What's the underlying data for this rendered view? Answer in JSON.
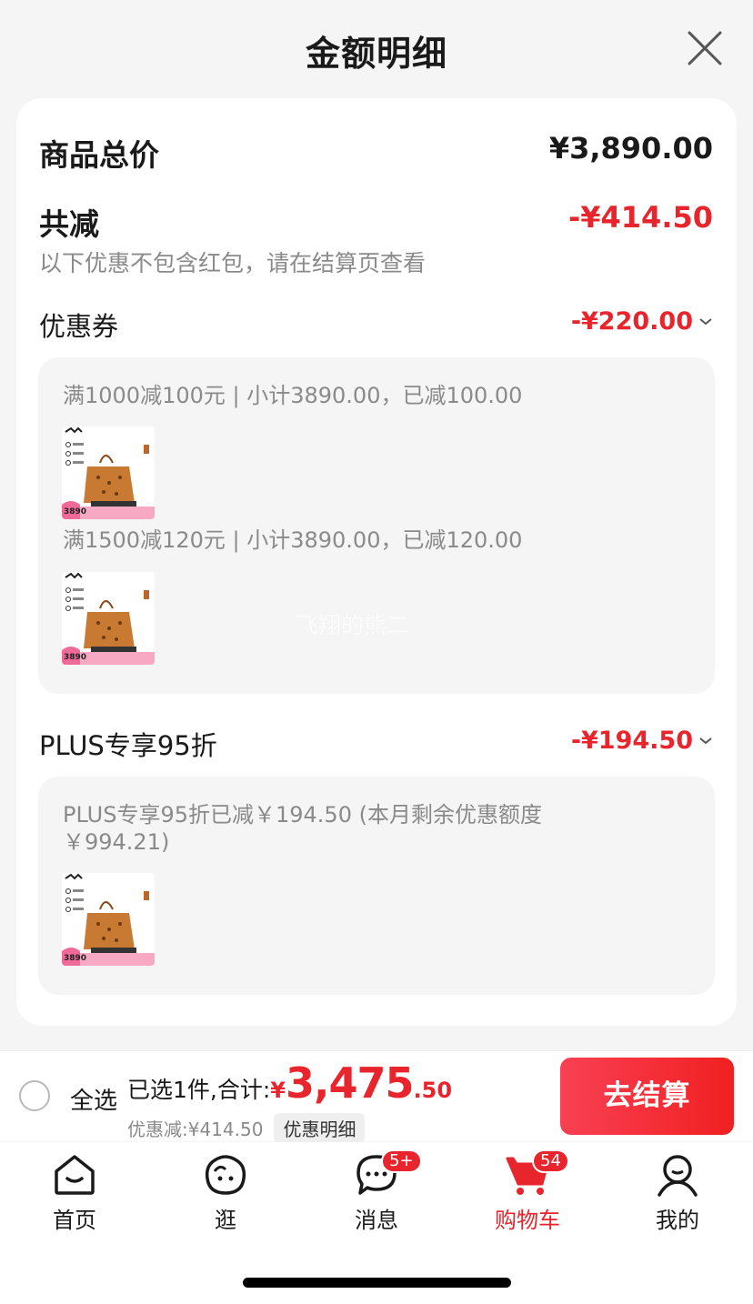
{
  "header": {
    "title": "金额明细"
  },
  "summary_card": {
    "total_label": "商品总价",
    "total_value": "¥3,890.00",
    "discount_label": "共减",
    "discount_value": "-¥414.50",
    "note": "以下优惠不包含红包，请在结算页查看"
  },
  "coupon_section": {
    "label": "优惠券",
    "amount": "-¥220.00",
    "rules": [
      {
        "text": "满1000减100元 | 小计3890.00，已减100.00",
        "thumb_price": "3890"
      },
      {
        "text": "满1500减120元 | 小计3890.00，已减120.00",
        "thumb_price": "3890"
      }
    ]
  },
  "plus_section": {
    "label": "PLUS专享95折",
    "amount": "-¥194.50",
    "detail_line1": "PLUS专享95折已减￥194.50 (本月剩余优惠额度",
    "detail_line2": "￥994.21)",
    "thumb_price": "3890"
  },
  "watermark": "飞翔的熊二",
  "bottom_bar": {
    "select_all": "全选",
    "selected_text": "已选1件,合计:",
    "currency": "¥",
    "total_int": "3,475",
    "total_dec": ".50",
    "discount_text": "优惠减:¥414.50",
    "detail_chip": "优惠明细",
    "checkout": "去结算"
  },
  "tab_bar": {
    "tabs": [
      {
        "label": "首页",
        "icon": "home-icon"
      },
      {
        "label": "逛",
        "icon": "explore-icon"
      },
      {
        "label": "消息",
        "icon": "message-icon",
        "badge": "5+"
      },
      {
        "label": "购物车",
        "icon": "cart-icon",
        "badge": "54",
        "active": true
      },
      {
        "label": "我的",
        "icon": "profile-icon"
      }
    ]
  },
  "colors": {
    "accent": "#e8242c",
    "muted": "#8a8a8a",
    "background": "#f5f5f5"
  }
}
